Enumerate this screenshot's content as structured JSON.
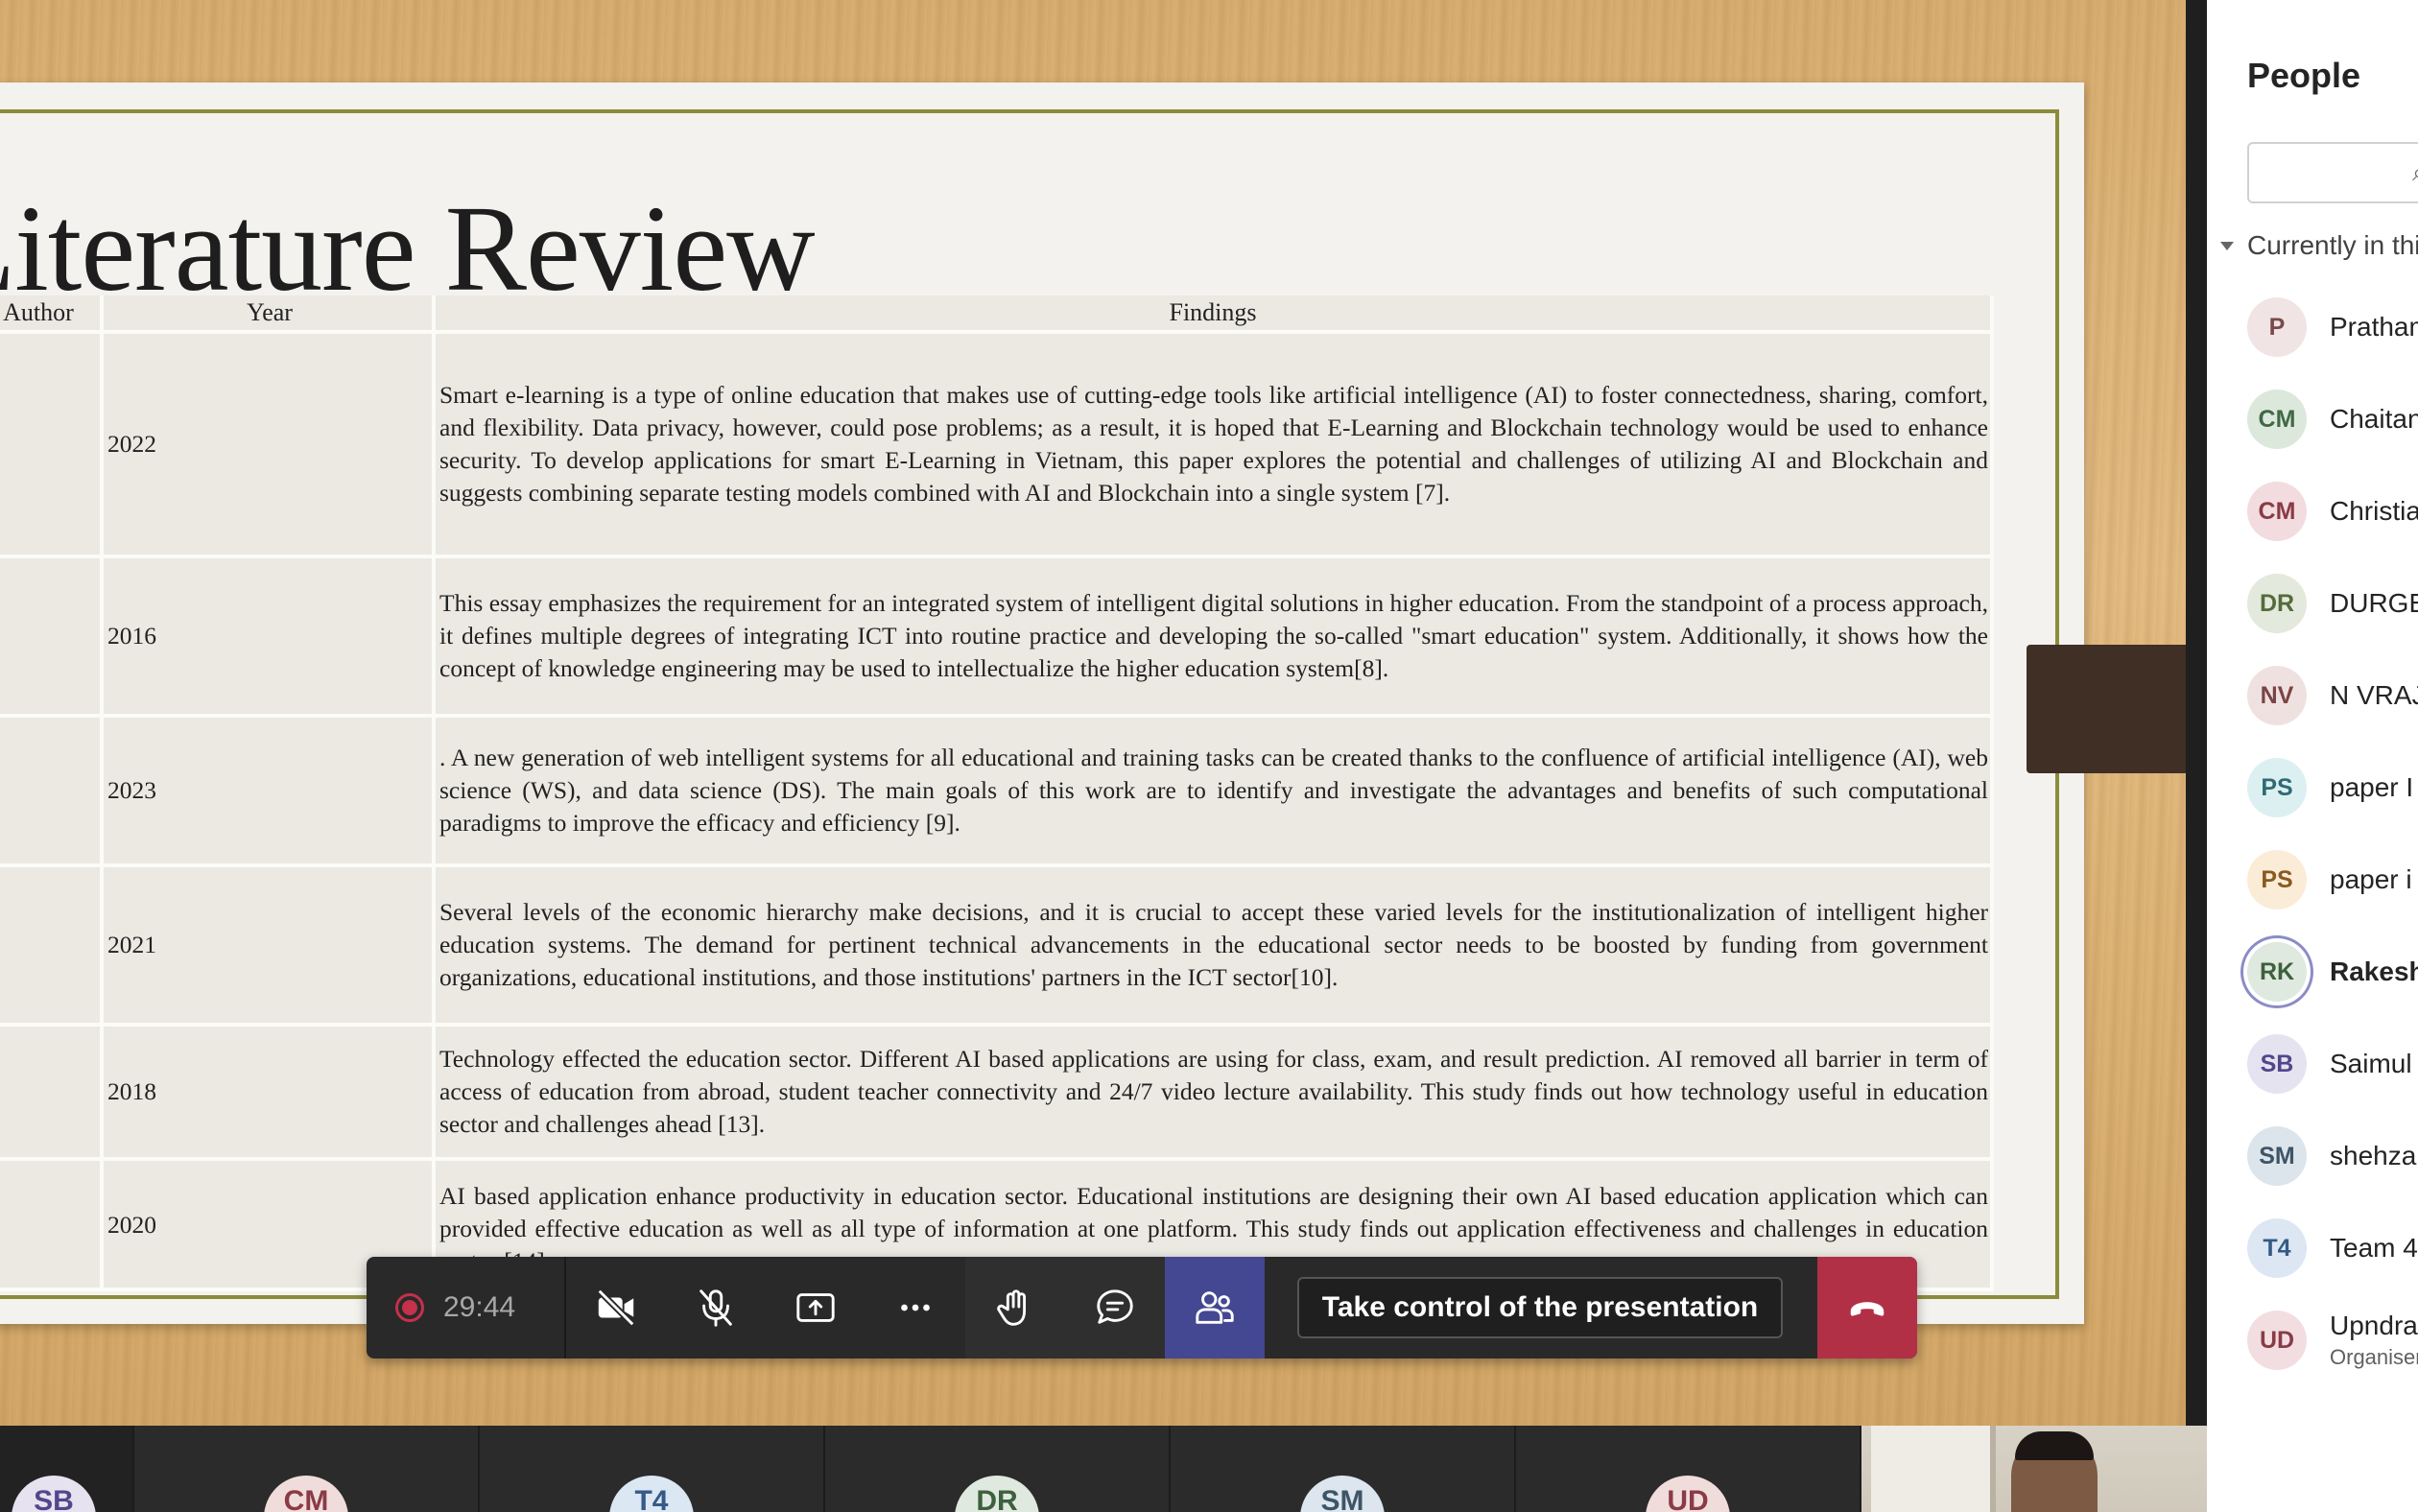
{
  "slide": {
    "title": "Literature Review",
    "table": {
      "headers": [
        "Author",
        "Year",
        "Findings"
      ],
      "rows": [
        {
          "year": "2022",
          "findings": "Smart e-learning is a type of online education that makes use of cutting-edge tools like artificial intelligence (AI) to foster connectedness, sharing, comfort, and flexibility. Data privacy, however, could pose problems; as a result, it is hoped that E-Learning and Blockchain technology would be used to enhance security. To develop applications for smart E-Learning in Vietnam, this paper explores the potential and challenges of utilizing AI and Blockchain and suggests combining separate testing models combined with AI and Blockchain into a single system [7]."
        },
        {
          "year": "2016",
          "findings": "This essay emphasizes the requirement for an integrated system of intelligent digital solutions in higher education. From the standpoint of a process approach, it defines multiple degrees of integrating ICT into routine practice and developing the so-called \"smart education\" system. Additionally, it shows how the concept of knowledge engineering may be used to intellectualize the higher education system[8]."
        },
        {
          "year": "2023",
          "findings": ". A new generation of web intelligent systems for all educational and training tasks can be created thanks to the confluence of artificial intelligence (AI), web science (WS), and data science (DS). The main goals of this work are to identify and investigate the advantages and benefits of such computational paradigms to improve the efficacy and efficiency [9]."
        },
        {
          "year": "2021",
          "findings": "Several levels of the economic hierarchy make decisions, and it is crucial to accept these varied levels for the institutionalization of intelligent higher education systems. The demand for pertinent technical advancements in the educational sector needs to be boosted by funding from government organizations, educational institutions, and those institutions' partners in the ICT sector[10]."
        },
        {
          "year": "2018",
          "findings": "Technology effected the education sector. Different AI based applications are using for class, exam, and result prediction. AI removed all barrier in term of access of education from abroad, student teacher connectivity and 24/7 video lecture availability. This study finds out how technology useful in education sector and challenges ahead [13]."
        },
        {
          "year": "2020",
          "findings": "AI based application enhance productivity in education sector. Educational institutions are designing their own AI based education application which can provided effective education as well as all type of information at one platform. This study finds out application effectiveness and challenges in education sector [14]."
        }
      ]
    }
  },
  "controls": {
    "timer": "29:44",
    "take_control_label": "Take control of the presentation",
    "icons": [
      "record-icon",
      "camera-off-icon",
      "mic-off-icon",
      "share-icon",
      "more-icon",
      "raise-hand-icon",
      "chat-icon",
      "people-icon",
      "hang-up-icon"
    ],
    "leave_color": "#b13046",
    "people_active_color": "#444791"
  },
  "strip": {
    "tiles": [
      {
        "initials": "SB",
        "color": "#e6e2f0"
      },
      {
        "initials": "CM",
        "color": "#f1dcdc"
      },
      {
        "initials": "T4",
        "color": "#dbe7f3"
      },
      {
        "initials": "DR",
        "color": "#dfe9df"
      },
      {
        "initials": "SM",
        "color": "#dde6ee"
      },
      {
        "initials": "UD",
        "color": "#f1dcdc"
      }
    ]
  },
  "people": {
    "title": "People",
    "search_placeholder": "",
    "section_label": "Currently in this meeting",
    "list": [
      {
        "initials": "P",
        "name": "Prathamesh",
        "bg": "#f0e4e4",
        "fg": "#7a4a4a"
      },
      {
        "initials": "CM",
        "name": "Chaitanya",
        "bg": "#dde8dd",
        "fg": "#3f6a45"
      },
      {
        "initials": "CM",
        "name": "Christian",
        "bg": "#f2dcdf",
        "fg": "#8a3b46"
      },
      {
        "initials": "DR",
        "name": "DURGESH",
        "bg": "#e3e9dc",
        "fg": "#556b3c"
      },
      {
        "initials": "NV",
        "name": "N VRAJ",
        "bg": "#f0e1e1",
        "fg": "#7a4545"
      },
      {
        "initials": "PS",
        "name": "paper I",
        "bg": "#dcf0f2",
        "fg": "#2f6b73"
      },
      {
        "initials": "PS",
        "name": "paper i",
        "bg": "#fbecd7",
        "fg": "#8a5a1f"
      },
      {
        "initials": "RK",
        "name": "Rakesh",
        "bg": "#dfe9df",
        "fg": "#3d603d",
        "bold": true,
        "ring": true
      },
      {
        "initials": "SB",
        "name": "Saimul",
        "bg": "#e6e3f1",
        "fg": "#52478a"
      },
      {
        "initials": "SM",
        "name": "shehza",
        "bg": "#dde5ec",
        "fg": "#3e5568"
      },
      {
        "initials": "T4",
        "name": "Team 4",
        "bg": "#dde7f3",
        "fg": "#355a86"
      },
      {
        "initials": "UD",
        "name": "Upndra",
        "sub": "Organiser",
        "bg": "#f2dee0",
        "fg": "#8a3b46"
      }
    ]
  }
}
